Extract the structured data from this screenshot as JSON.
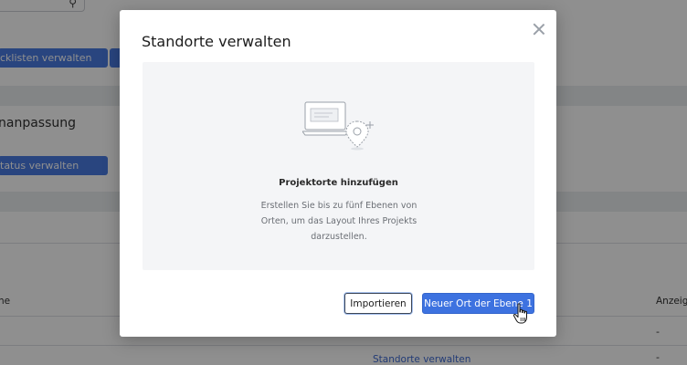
{
  "background": {
    "checklist_button": "cklisten verwalten",
    "section_heading": "nanpassung",
    "status_button": "tatus verwalten",
    "column_left": "ne",
    "column_right": "Anzeig",
    "dash_1": "-",
    "dash_2": "-",
    "link_locations": "Standorte verwalten",
    "search_icon": "search-icon"
  },
  "modal": {
    "title": "Standorte verwalten",
    "close_icon": "close-icon",
    "empty_state": {
      "illustration": "laptop-with-location-pin-illustration",
      "title": "Projektorte hinzufügen",
      "description": "Erstellen Sie bis zu fünf Ebenen von Orten, um das Layout Ihres Projekts darzustellen."
    },
    "buttons": {
      "import": "Importieren",
      "new_level": "Neuer Ort der Ebene 1"
    }
  },
  "colors": {
    "primary": "#3d72e0",
    "overlay": "rgba(20,20,20,0.48)"
  }
}
